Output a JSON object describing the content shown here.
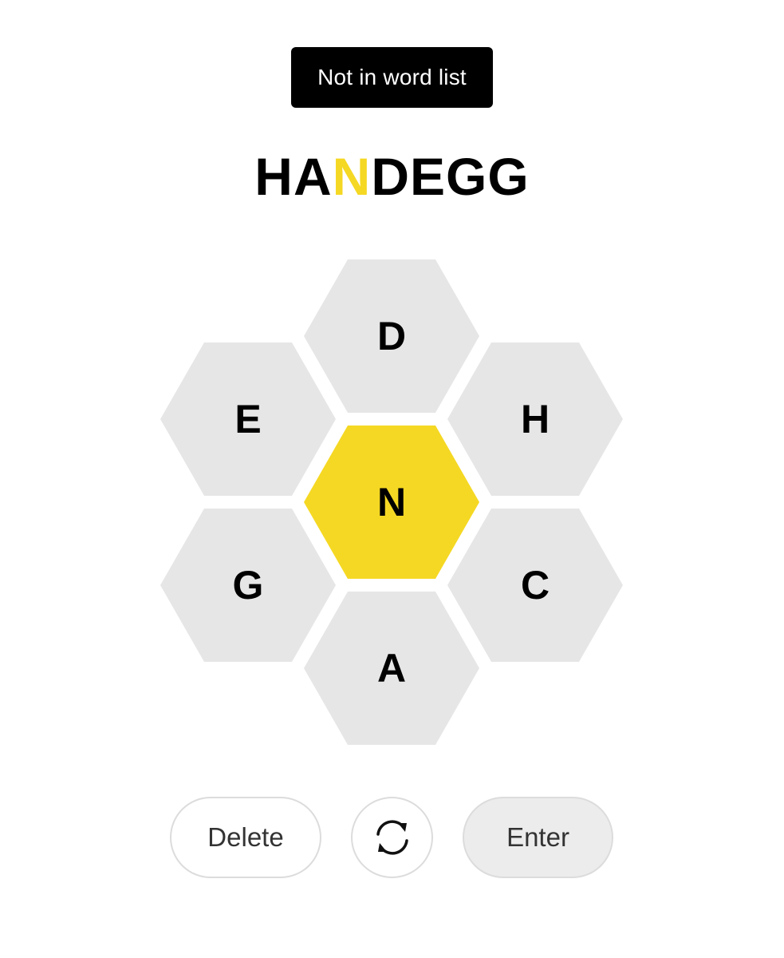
{
  "toast": {
    "message": "Not in word list"
  },
  "entry": {
    "letters": [
      "H",
      "A",
      "N",
      "D",
      "E",
      "G",
      "G"
    ],
    "center_letter": "N",
    "highlight_color": "#f5d823"
  },
  "hive": {
    "center": {
      "letter": "N",
      "color": "#f5d823"
    },
    "outer": {
      "top": "D",
      "upper_right": "H",
      "lower_right": "C",
      "bottom": "A",
      "lower_left": "G",
      "upper_left": "E",
      "color": "#e6e6e6"
    }
  },
  "controls": {
    "delete_label": "Delete",
    "shuffle_icon": "shuffle-icon",
    "enter_label": "Enter"
  }
}
